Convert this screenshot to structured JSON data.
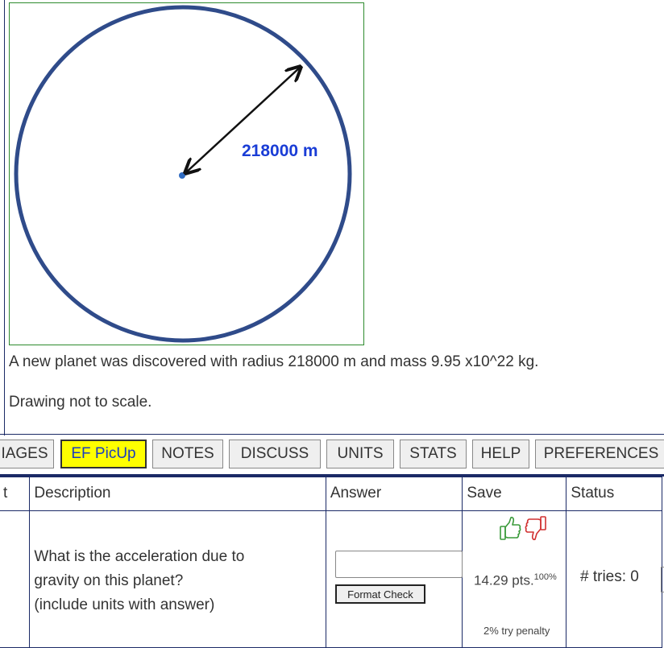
{
  "figure": {
    "radius_label": "218000 m",
    "circle_color": "#2f4b8a",
    "label_color": "#1a3dd6"
  },
  "problem": {
    "description": "A new planet was discovered with radius 218000 m and mass 9.95 x10^22 kg.",
    "note": "Drawing not to scale."
  },
  "tabs": [
    {
      "label": "IAGES"
    },
    {
      "label": "EF PicUp",
      "highlighted": true
    },
    {
      "label": "NOTES"
    },
    {
      "label": "DISCUSS"
    },
    {
      "label": "UNITS"
    },
    {
      "label": "STATS"
    },
    {
      "label": "HELP"
    },
    {
      "label": "PREFERENCES"
    }
  ],
  "table": {
    "headers": {
      "part": "t",
      "description": "Description",
      "answer": "Answer",
      "save": "Save",
      "status": "Status"
    },
    "question": {
      "line1": "What is the acceleration due to",
      "line2": "gravity on this planet?",
      "line3": "(include units with answer)"
    },
    "answer": {
      "value": "",
      "button": "Format Check"
    },
    "save": {
      "points": "14.29 pts.",
      "percent": "100%",
      "penalty": "2% try penalty",
      "like_icon": "thumbs-up-icon",
      "dislike_icon": "thumbs-down-icon"
    },
    "status": {
      "tries": "# tries: 0"
    }
  }
}
